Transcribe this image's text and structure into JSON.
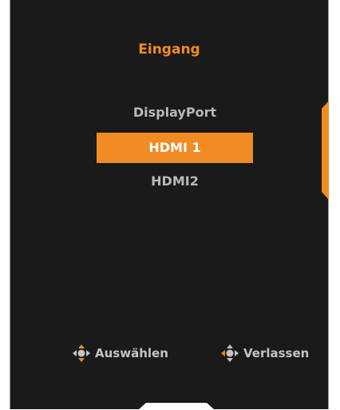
{
  "osd": {
    "title": "Eingang",
    "inputs": [
      {
        "label": "DisplayPort",
        "selected": false
      },
      {
        "label": "HDMI 1",
        "selected": true
      },
      {
        "label": "HDMI2",
        "selected": false
      }
    ],
    "hints": {
      "select": {
        "icon": "joystick-up-down-icon",
        "label": "Auswählen"
      },
      "exit": {
        "icon": "joystick-left-icon",
        "label": "Verlassen"
      }
    }
  },
  "colors": {
    "accent": "#f08c23",
    "background": "#1a1a1a",
    "text": "#b9b9b9",
    "selected_text": "#ffffff"
  }
}
